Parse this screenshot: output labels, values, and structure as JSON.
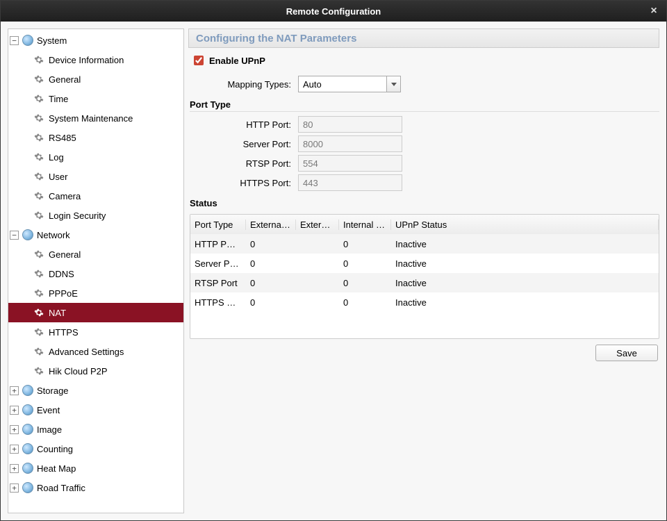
{
  "window_title": "Remote Configuration",
  "tree": {
    "system": {
      "label": "System",
      "expanded": true,
      "children": [
        {
          "label": "Device Information"
        },
        {
          "label": "General"
        },
        {
          "label": "Time"
        },
        {
          "label": "System Maintenance"
        },
        {
          "label": "RS485"
        },
        {
          "label": "Log"
        },
        {
          "label": "User"
        },
        {
          "label": "Camera"
        },
        {
          "label": "Login Security"
        }
      ]
    },
    "network": {
      "label": "Network",
      "expanded": true,
      "children": [
        {
          "label": "General"
        },
        {
          "label": "DDNS"
        },
        {
          "label": "PPPoE"
        },
        {
          "label": "NAT",
          "selected": true
        },
        {
          "label": "HTTPS"
        },
        {
          "label": "Advanced Settings"
        },
        {
          "label": "Hik Cloud P2P"
        }
      ]
    },
    "storage": {
      "label": "Storage",
      "expanded": false
    },
    "event": {
      "label": "Event",
      "expanded": false
    },
    "image": {
      "label": "Image",
      "expanded": false
    },
    "counting": {
      "label": "Counting",
      "expanded": false
    },
    "heatmap": {
      "label": "Heat Map",
      "expanded": false
    },
    "road": {
      "label": "Road Traffic",
      "expanded": false
    }
  },
  "panel": {
    "title": "Configuring the NAT Parameters",
    "enable_upnp_label": "Enable UPnP",
    "enable_upnp_checked": true,
    "mapping_types_label": "Mapping Types:",
    "mapping_types_value": "Auto",
    "port_type_heading": "Port Type",
    "ports": {
      "http": {
        "label": "HTTP Port:",
        "value": "80"
      },
      "server": {
        "label": "Server Port:",
        "value": "8000"
      },
      "rtsp": {
        "label": "RTSP Port:",
        "value": "554"
      },
      "https": {
        "label": "HTTPS Port:",
        "value": "443"
      }
    },
    "status_heading": "Status",
    "status_headers": [
      "Port Type",
      "External…",
      "Extern…",
      "Internal …",
      "UPnP Status"
    ],
    "status_rows": [
      {
        "port_type": "HTTP P…",
        "external": "0",
        "extern": "",
        "internal": "0",
        "upnp": "Inactive"
      },
      {
        "port_type": "Server P…",
        "external": "0",
        "extern": "",
        "internal": "0",
        "upnp": "Inactive"
      },
      {
        "port_type": "RTSP Port",
        "external": "0",
        "extern": "",
        "internal": "0",
        "upnp": "Inactive"
      },
      {
        "port_type": "HTTPS …",
        "external": "0",
        "extern": "",
        "internal": "0",
        "upnp": "Inactive"
      }
    ],
    "save_label": "Save"
  }
}
